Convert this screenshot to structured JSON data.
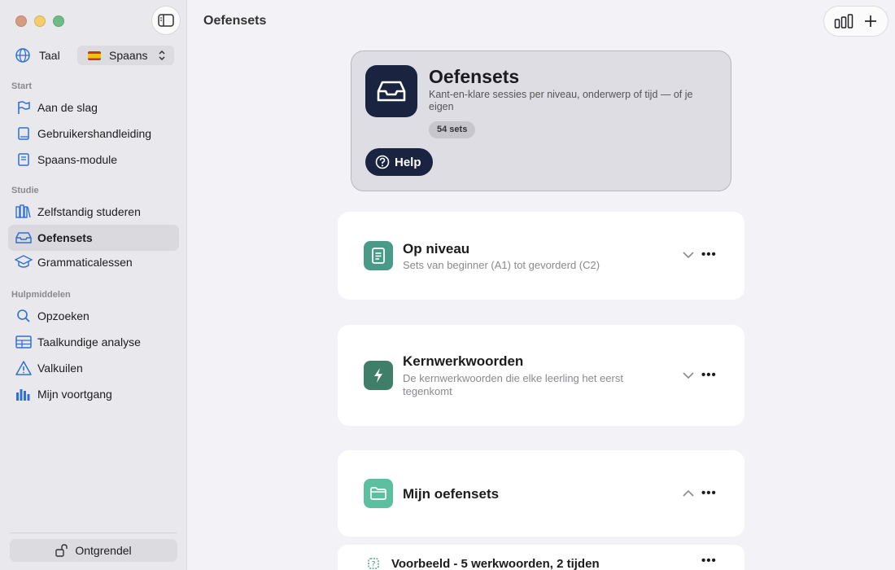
{
  "sidebar": {
    "language_label": "Taal",
    "language_value": "Spaans",
    "sections": {
      "start": "Start",
      "study": "Studie",
      "tools": "Hulpmiddelen"
    },
    "items": [
      {
        "label": "Aan de slag"
      },
      {
        "label": "Gebruikershandleiding"
      },
      {
        "label": "Spaans-module"
      },
      {
        "label": "Zelfstandig studeren"
      },
      {
        "label": "Oefensets"
      },
      {
        "label": "Grammaticalessen"
      },
      {
        "label": "Opzoeken"
      },
      {
        "label": "Taalkundige analyse"
      },
      {
        "label": "Valkuilen"
      },
      {
        "label": "Mijn voortgang"
      }
    ],
    "unlock_label": "Ontgrendel"
  },
  "header": {
    "title": "Oefensets"
  },
  "hero": {
    "title": "Oefensets",
    "description": "Kant-en-klare sessies per niveau, onderwerp of tijd — of je eigen",
    "badge": "54 sets",
    "help_label": "Help"
  },
  "cards": [
    {
      "title": "Op niveau",
      "subtitle": "Sets van beginner (A1) tot gevorderd (C2)",
      "icon": "document-icon",
      "color": "#4a9a8a"
    },
    {
      "title": "Kernwerkwoorden",
      "subtitle": "De kernwerkwoorden die elke leerling het eerst tegenkomt",
      "icon": "bolt-icon",
      "color": "#3f7f6a"
    },
    {
      "title": "Mijn oefensets",
      "subtitle": "",
      "icon": "folder-icon",
      "color": "#5cbfa0"
    }
  ],
  "list_item": {
    "title": "Voorbeeld - 5 werkwoorden, 2 tijden"
  },
  "colors": {
    "accent": "#1a2440",
    "sidebar_icon": "#2f6fd6"
  }
}
